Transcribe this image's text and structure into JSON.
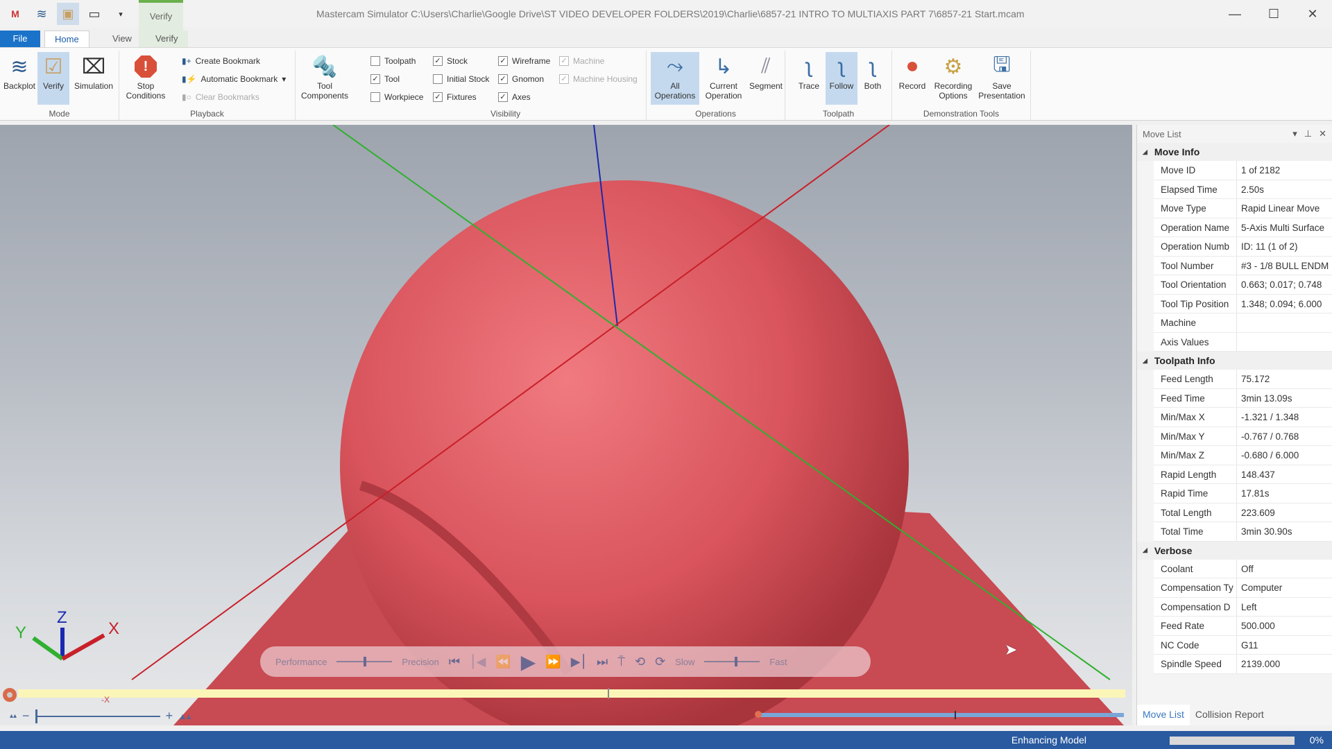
{
  "window": {
    "title": "Mastercam Simulator  C:\\Users\\Charlie\\Google Drive\\ST VIDEO DEVELOPER FOLDERS\\2019\\Charlie\\6857-21 INTRO TO MULTIAXIS PART 7\\6857-21 Start.mcam",
    "contextual_tab_group": "Verify",
    "controls": {
      "minimize": "—",
      "maximize": "☐",
      "close": "✕"
    }
  },
  "tabs": [
    {
      "label": "File"
    },
    {
      "label": "Home",
      "active": true
    },
    {
      "label": "View"
    },
    {
      "label": "Verify"
    }
  ],
  "ribbon": {
    "mode": {
      "label": "Mode",
      "buttons": [
        {
          "label": "Backplot",
          "icon": "backplot-icon"
        },
        {
          "label": "Verify",
          "icon": "verify-icon",
          "active": true
        },
        {
          "label": "Simulation",
          "icon": "simulation-icon"
        }
      ]
    },
    "playback": {
      "label": "Playback",
      "stop_conditions": "Stop Conditions",
      "create_bookmark": "Create Bookmark",
      "automatic_bookmark": "Automatic Bookmark",
      "clear_bookmarks": "Clear Bookmarks"
    },
    "tool_components": "Tool Components",
    "visibility": {
      "label": "Visibility",
      "items": [
        {
          "label": "Toolpath",
          "checked": false,
          "enabled": true
        },
        {
          "label": "Tool",
          "checked": true,
          "enabled": true
        },
        {
          "label": "Workpiece",
          "checked": false,
          "enabled": true
        },
        {
          "label": "Stock",
          "checked": true,
          "enabled": true
        },
        {
          "label": "Initial Stock",
          "checked": false,
          "enabled": true
        },
        {
          "label": "Fixtures",
          "checked": true,
          "enabled": true
        },
        {
          "label": "Wireframe",
          "checked": true,
          "enabled": true
        },
        {
          "label": "Gnomon",
          "checked": true,
          "enabled": true
        },
        {
          "label": "Axes",
          "checked": true,
          "enabled": true
        },
        {
          "label": "Machine",
          "checked": true,
          "enabled": false
        },
        {
          "label": "Machine Housing",
          "checked": true,
          "enabled": false
        }
      ]
    },
    "operations": {
      "label": "Operations",
      "buttons": [
        {
          "label": "All Operations",
          "active": true
        },
        {
          "label": "Current Operation"
        },
        {
          "label": "Segment"
        }
      ]
    },
    "toolpath": {
      "label": "Toolpath",
      "buttons": [
        {
          "label": "Trace"
        },
        {
          "label": "Follow",
          "active": true
        },
        {
          "label": "Both"
        }
      ]
    },
    "demonstration": {
      "label": "Demonstration Tools",
      "buttons": [
        {
          "label": "Record"
        },
        {
          "label": "Recording Options"
        },
        {
          "label": "Save Presentation"
        }
      ]
    }
  },
  "viewport": {
    "gnomon": {
      "x": "X",
      "y": "Y",
      "z": "Z"
    },
    "neg_x_label": "-X",
    "playbar": {
      "performance": "Performance",
      "precision": "Precision",
      "slow": "Slow",
      "fast": "Fast",
      "quality_slider": 0.5,
      "speed_slider": 0.55
    },
    "zoom_minus": "−",
    "zoom_plus": "+"
  },
  "move_list": {
    "title": "Move List",
    "sections": [
      {
        "name": "Move Info",
        "rows": [
          {
            "k": "Move ID",
            "v": "1 of 2182"
          },
          {
            "k": "Elapsed Time",
            "v": "2.50s"
          },
          {
            "k": "Move Type",
            "v": "Rapid Linear Move"
          },
          {
            "k": "Operation Name",
            "v": "5-Axis Multi Surface"
          },
          {
            "k": "Operation Numb",
            "v": "ID: 11 (1 of 2)"
          },
          {
            "k": "Tool Number",
            "v": "#3 - 1/8 BULL ENDM"
          },
          {
            "k": "Tool Orientation",
            "v": "0.663; 0.017; 0.748"
          },
          {
            "k": "Tool Tip Position",
            "v": "1.348; 0.094; 6.000"
          },
          {
            "k": "Machine",
            "v": ""
          },
          {
            "k": "Axis Values",
            "v": ""
          }
        ]
      },
      {
        "name": "Toolpath Info",
        "rows": [
          {
            "k": "Feed Length",
            "v": "75.172"
          },
          {
            "k": "Feed Time",
            "v": "3min 13.09s"
          },
          {
            "k": "Min/Max X",
            "v": "-1.321 / 1.348"
          },
          {
            "k": "Min/Max Y",
            "v": "-0.767 / 0.768"
          },
          {
            "k": "Min/Max Z",
            "v": "-0.680 / 6.000"
          },
          {
            "k": "Rapid Length",
            "v": "148.437"
          },
          {
            "k": "Rapid Time",
            "v": "17.81s"
          },
          {
            "k": "Total Length",
            "v": "223.609"
          },
          {
            "k": "Total Time",
            "v": "3min 30.90s"
          }
        ]
      },
      {
        "name": "Verbose",
        "rows": [
          {
            "k": "Coolant",
            "v": "Off"
          },
          {
            "k": "Compensation Ty",
            "v": "Computer"
          },
          {
            "k": "Compensation D",
            "v": "Left"
          },
          {
            "k": "Feed Rate",
            "v": "500.000"
          },
          {
            "k": "NC Code",
            "v": "G11"
          },
          {
            "k": "Spindle Speed",
            "v": "2139.000"
          }
        ]
      }
    ],
    "tabs": [
      "Move List",
      "Collision Report"
    ]
  },
  "status": {
    "text": "Enhancing Model",
    "progress": 0,
    "progress_label": "0%"
  }
}
